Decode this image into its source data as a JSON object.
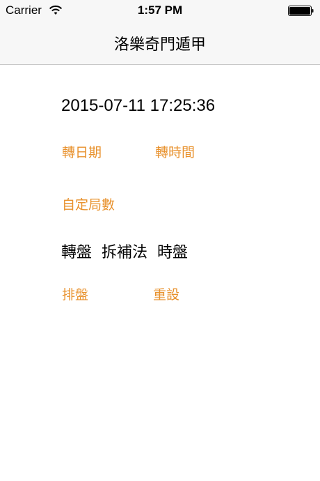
{
  "status_bar": {
    "carrier": "Carrier",
    "time": "1:57 PM"
  },
  "nav": {
    "title": "洛樂奇門遁甲"
  },
  "main": {
    "datetime": "2015-07-11 17:25:36",
    "change_date_label": "轉日期",
    "change_time_label": "轉時間",
    "custom_count_label": "自定局數",
    "modes": [
      "轉盤",
      "拆補法",
      "時盤"
    ],
    "arrange_label": "排盤",
    "reset_label": "重設"
  },
  "colors": {
    "accent": "#e8912c",
    "bar_background": "#f7f7f7"
  },
  "icons": [
    "wifi-icon",
    "battery-icon"
  ]
}
